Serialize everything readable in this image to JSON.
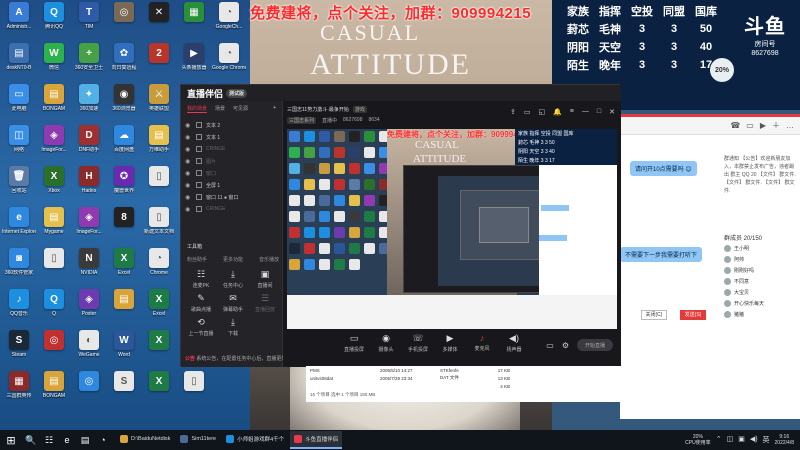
{
  "promo_text": "免费建将，点个关注，加群：909994215",
  "bg_text": {
    "line1": "CASUAL",
    "line2": "ATTITUDE"
  },
  "rank_table": {
    "rows": [
      [
        "家族",
        "指挥",
        "空投",
        "同盟",
        "国库"
      ],
      [
        "葑芯",
        "毛神",
        "3",
        "3",
        "50"
      ],
      [
        "阴阳",
        "天空",
        "3",
        "3",
        "40"
      ],
      [
        "陌生",
        "晚年",
        "3",
        "3",
        "17"
      ]
    ]
  },
  "logo": {
    "mark": "斗鱼",
    "sub": "房间号",
    "room": "8627698"
  },
  "badge_20": "20%",
  "desktop_icons": [
    {
      "label": "Administr...",
      "color": "#3a7bd5",
      "glyph": "A"
    },
    {
      "label": "腾讯QQ",
      "color": "#1d8fe1",
      "glyph": "Q"
    },
    {
      "label": "TIM",
      "color": "#2e5aa7",
      "glyph": "T"
    },
    {
      "label": "",
      "color": "#7a6a55",
      "glyph": "◎"
    },
    {
      "label": "",
      "color": "#222",
      "glyph": "✕"
    },
    {
      "label": "",
      "color": "#2a8f3a",
      "glyph": "▦"
    },
    {
      "label": "GoogleCh...",
      "color": "#e8e8e8",
      "glyph": "◔"
    },
    {
      "label": "deskNT0-B",
      "color": "#3b6fb0",
      "glyph": "▤"
    },
    {
      "label": "微信",
      "color": "#2bb24c",
      "glyph": "W"
    },
    {
      "label": "360安全卫士",
      "color": "#46a146",
      "glyph": "+"
    },
    {
      "label": "向日葵远程",
      "color": "#2f6fbd",
      "glyph": "✿"
    },
    {
      "label": "",
      "color": "#b9342b",
      "glyph": "2"
    },
    {
      "label": "头条播放器",
      "color": "#2a3f6b",
      "glyph": "▶"
    },
    {
      "label": "Google Chrome",
      "color": "#e8e8e8",
      "glyph": "◔"
    },
    {
      "label": "此电脑",
      "color": "#3a8ee6",
      "glyph": "▭"
    },
    {
      "label": "BONGAM",
      "color": "#d9a53a",
      "glyph": "▤"
    },
    {
      "label": "360加速",
      "color": "#52b0e5",
      "glyph": "✦"
    },
    {
      "label": "360浏览器",
      "color": "#333",
      "glyph": "◉"
    },
    {
      "label": "英雄联盟",
      "color": "#c89b3c",
      "glyph": "⚔"
    },
    {
      "label": "",
      "color": "#e5c04d",
      "glyph": "▤"
    },
    {
      "label": "",
      "color": "#c03030",
      "glyph": "▣"
    },
    {
      "label": "网络",
      "color": "#3a8ee6",
      "glyph": "◫"
    },
    {
      "label": "ImageFor...",
      "color": "#8f3ab0",
      "glyph": "◈"
    },
    {
      "label": "DNF助手",
      "color": "#a03030",
      "glyph": "D"
    },
    {
      "label": "百度网盘",
      "color": "#2f88e0",
      "glyph": "☁"
    },
    {
      "label": "万维助手",
      "color": "#e5c04d",
      "glyph": "▤"
    },
    {
      "label": "",
      "color": "#e8e8e8",
      "glyph": "▯"
    },
    {
      "label": "",
      "color": "#c03030",
      "glyph": "▣"
    },
    {
      "label": "回收站",
      "color": "#5b7aa5",
      "glyph": "🗑"
    },
    {
      "label": "Xbox",
      "color": "#2a6f2a",
      "glyph": "X"
    },
    {
      "label": "Hades",
      "color": "#8a2a2a",
      "glyph": "H"
    },
    {
      "label": "魔兽世界",
      "color": "#6a2ab0",
      "glyph": "✪"
    },
    {
      "label": "",
      "color": "#e8e8e8",
      "glyph": "▯"
    },
    {
      "label": "",
      "color": "#e8e8e8",
      "glyph": "▯"
    },
    {
      "label": "",
      "color": "#4a6a9a",
      "glyph": "▭"
    },
    {
      "label": "Internet Explorer",
      "color": "#2f88e0",
      "glyph": "e"
    },
    {
      "label": "Mygame",
      "color": "#e5c04d",
      "glyph": "▤"
    },
    {
      "label": "ImageFor...",
      "color": "#8f3ab0",
      "glyph": "◈"
    },
    {
      "label": "",
      "color": "#222",
      "glyph": "8"
    },
    {
      "label": "新建文本文档",
      "color": "#e8e8e8",
      "glyph": "▯"
    },
    {
      "label": "",
      "color": "#e8e8e8",
      "glyph": "◔"
    },
    {
      "label": "",
      "color": "#4a6a9a",
      "glyph": "▭"
    },
    {
      "label": "360软件管家",
      "color": "#2f88e0",
      "glyph": "◙"
    },
    {
      "label": "",
      "color": "#e8e8e8",
      "glyph": "▯"
    },
    {
      "label": "NVIDIA",
      "color": "#3a3a3a",
      "glyph": "N"
    },
    {
      "label": "Excel",
      "color": "#1e7b45",
      "glyph": "X"
    },
    {
      "label": "Chrome",
      "color": "#e8e8e8",
      "glyph": "◔"
    },
    {
      "label": "",
      "color": "#e8e8e8",
      "glyph": "▯"
    },
    {
      "label": "",
      "color": "#c03030",
      "glyph": "▣"
    },
    {
      "label": "QQ音乐",
      "color": "#1d8fe1",
      "glyph": "♪"
    },
    {
      "label": "Q",
      "color": "#1d8fe1",
      "glyph": "Q"
    },
    {
      "label": "Poster",
      "color": "#6d3ab0",
      "glyph": "◈"
    },
    {
      "label": "",
      "color": "#d9a53a",
      "glyph": "▤"
    },
    {
      "label": "Excel",
      "color": "#1e7b45",
      "glyph": "X"
    },
    {
      "label": "",
      "color": "#e8e8e8",
      "glyph": "▯"
    },
    {
      "label": "",
      "color": "#4a6a9a",
      "glyph": "▭"
    },
    {
      "label": "Steam",
      "color": "#1b2838",
      "glyph": "S"
    },
    {
      "label": "",
      "color": "#c03030",
      "glyph": "◎"
    },
    {
      "label": "WeGame",
      "color": "#e8e8e8",
      "glyph": "◐"
    },
    {
      "label": "Word",
      "color": "#2b579a",
      "glyph": "W"
    },
    {
      "label": "",
      "color": "#1e7b45",
      "glyph": "X"
    },
    {
      "label": "",
      "color": "#e8e8e8",
      "glyph": "▯"
    },
    {
      "label": "",
      "color": "#4a6a9a",
      "glyph": "▭"
    },
    {
      "label": "三国群英传",
      "color": "#8a2a2a",
      "glyph": "▦"
    },
    {
      "label": "BONGAM",
      "color": "#d9a53a",
      "glyph": "▤"
    },
    {
      "label": "",
      "color": "#2f88e0",
      "glyph": "◎"
    },
    {
      "label": "",
      "color": "#e8e8e8",
      "glyph": "S"
    },
    {
      "label": "",
      "color": "#1e7b45",
      "glyph": "X"
    },
    {
      "label": "",
      "color": "#e8e8e8",
      "glyph": "▯"
    }
  ],
  "app": {
    "brand": "直播伴侣",
    "brand_badge": "测试版",
    "tabs": [
      {
        "label": "我的场景",
        "active": true
      },
      {
        "label": "场景",
        "active": false
      },
      {
        "label": "可见源",
        "active": false
      }
    ],
    "plus": "+",
    "sources": [
      {
        "label": "文本 2",
        "dim": false
      },
      {
        "label": "文本 1",
        "dim": false
      },
      {
        "label": "CRINGE",
        "dim": true
      },
      {
        "label": "图片",
        "dim": true
      },
      {
        "label": "窗口",
        "dim": true
      },
      {
        "label": "全屏 1",
        "dim": false
      },
      {
        "label": "窗口 11 ● 窗口",
        "dim": false
      },
      {
        "label": "CRINGE",
        "dim": true
      }
    ],
    "tools_title": "工具箱",
    "tools_sub": [
      "粉丝助手",
      "更多功能",
      "音乐播放"
    ],
    "tools": [
      {
        "label": "连麦PK",
        "glyph": "☷",
        "dim": false
      },
      {
        "label": "任务中心",
        "glyph": "⤓",
        "dim": false
      },
      {
        "label": "直播间",
        "glyph": "▣",
        "dim": false
      },
      {
        "label": "歌曲点播",
        "glyph": "✎",
        "dim": false
      },
      {
        "label": "弹幕助手",
        "glyph": "✉",
        "dim": false
      },
      {
        "label": "直播回放",
        "glyph": "☰",
        "dim": true
      },
      {
        "label": "上一节直播",
        "glyph": "⟲",
        "dim": false
      },
      {
        "label": "下载",
        "glyph": "⤓",
        "dim": false
      },
      {
        "label": "",
        "glyph": "",
        "dim": true
      }
    ],
    "notice_prefix": "公告",
    "notice": "系统公告，在配置任务中心后，直播更简单",
    "room_title": "三国志11势力激斗·最争开始",
    "room_tag": "游戏",
    "room_id": "三国志系列",
    "room_meta": [
      "直播中",
      "8627698",
      "8634"
    ],
    "right_tools": [
      "⇪",
      "▭",
      "◱",
      "🔔",
      "≡",
      "—",
      "□",
      "✕"
    ],
    "toolbar": [
      {
        "label": "直播投屏",
        "glyph": "▭",
        "live": false
      },
      {
        "label": "摄像头",
        "glyph": "◉",
        "live": false
      },
      {
        "label": "手机投屏",
        "glyph": "☏",
        "live": false
      },
      {
        "label": "多媒体",
        "glyph": "▶",
        "live": false
      },
      {
        "label": "麦克风",
        "glyph": "♪",
        "live": true
      },
      {
        "label": "扬声器",
        "glyph": "◀)",
        "live": false
      }
    ],
    "toolbar_right_icons": [
      "▭",
      "⚙"
    ],
    "start_label": "开始直播"
  },
  "explorer": {
    "rows": [
      {
        "name": "PMS",
        "date": "2006/5/10 14:27",
        "type": "STKfenfe",
        "size": "17 KB"
      },
      {
        "name": "unitvs08dat",
        "date": "2006/7/29 23:34",
        "type": "DAT 文件",
        "size": "13 KB"
      },
      {
        "name": "",
        "date": "",
        "type": "",
        "size": "4 KB"
      }
    ],
    "status": "16 个项目   选中 1 个项目  150 MB"
  },
  "chat": {
    "bar_icons": [
      "☎",
      "▭",
      "▶",
      "＋",
      "…"
    ],
    "bubble1": "请问开10点需要吗 😊",
    "bubble2": "不需要下一步我需要打听下",
    "notice": "群通知 【公告】欢迎新朋友加入，本群禁止发布广告，违者踢出 群主 QQ 20 【文件】 群文件. 【文件】 群文件. 【文件】 群文件.",
    "members_title": "群成员 20/150",
    "members": [
      "王小明",
      "阿帅",
      "刚刚好吗",
      "不同意",
      "大宝贝",
      "开心快乐每天",
      "猪猪"
    ],
    "close_label": "关闭(C)",
    "send_label": "发送(S)"
  },
  "taskbar": {
    "start_glyph": "⊞",
    "pinned": [
      "🔍",
      "☷",
      "e",
      "▤",
      "◔"
    ],
    "tasks": [
      {
        "label": "D:\\BaiduNetdisk",
        "color": "#d9a53a",
        "active": false
      },
      {
        "label": "Sim11tere",
        "color": "#4a6a9a",
        "active": false
      },
      {
        "label": "小师姐游戏群4千个",
        "color": "#1d8fe1",
        "active": false
      },
      {
        "label": "斗鱼直播伴侣",
        "color": "#e9394c",
        "active": true
      }
    ],
    "tray_cpu": "20%",
    "tray_cpu_label": "CPU使用率",
    "tray_icons": [
      "⌃",
      "◫",
      "▣",
      "◀)",
      "英"
    ],
    "time": "9:16",
    "date": "2022/4/8"
  }
}
